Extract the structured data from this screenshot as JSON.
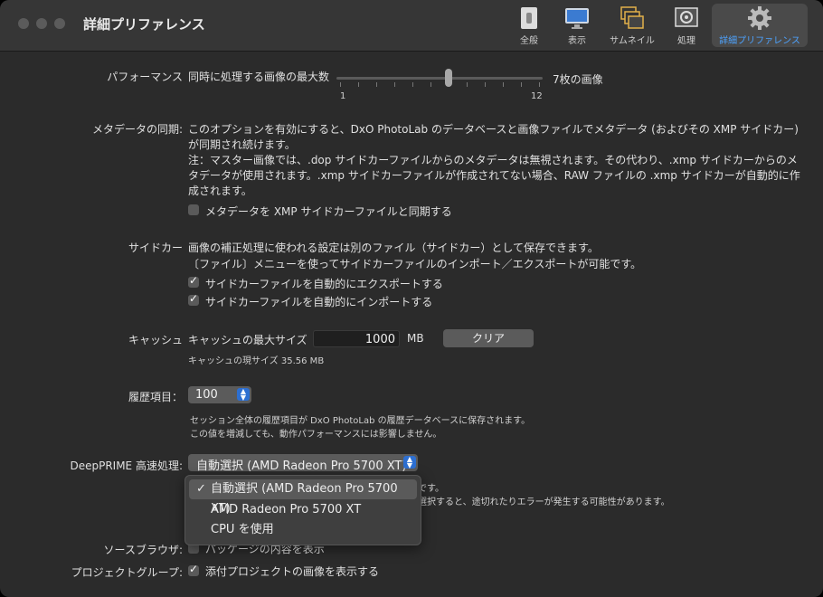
{
  "window": {
    "title": "詳細プリファレンス"
  },
  "toolbar": {
    "items": [
      {
        "label": "全般",
        "icon": "switch-icon"
      },
      {
        "label": "表示",
        "icon": "monitor-icon"
      },
      {
        "label": "サムネイル",
        "icon": "thumbnails-icon"
      },
      {
        "label": "処理",
        "icon": "processing-icon"
      },
      {
        "label": "詳細プリファレンス",
        "icon": "gear-icon"
      }
    ]
  },
  "performance": {
    "label": "パフォーマンス",
    "desc": "同時に処理する画像の最大数",
    "min": "1",
    "max": "12",
    "value_text": "7枚の画像",
    "value": 7
  },
  "metadata": {
    "label": "メタデータの同期:",
    "line1": "このオプションを有効にすると、DxO PhotoLab のデータベースと画像ファイルでメタデータ (およびその XMP サイドカー)",
    "line2": "が同期され続けます。",
    "line3": "注：マスター画像では、.dop サイドカーファイルからのメタデータは無視されます。その代わり、.xmp サイドカーからのメ",
    "line4": "タデータが使用されます。.xmp サイドカーファイルが作成されてない場合、RAW ファイルの .xmp サイドカーが自動的に作",
    "line5": "成されます。",
    "checkbox": "メタデータを XMP サイドカーファイルと同期する"
  },
  "sidecar": {
    "label": "サイドカー",
    "line1": "画像の補正処理に使われる設定は別のファイル（サイドカー）として保存できます。",
    "line2": "〔ファイル〕メニューを使ってサイドカーファイルのインポート／エクスポートが可能です。",
    "export": "サイドカーファイルを自動的にエクスポートする",
    "import": "サイドカーファイルを自動的にインポートする"
  },
  "cache": {
    "label": "キャッシュ",
    "max_label": "キャッシュの最大サイズ",
    "value": "1000",
    "unit": "MB",
    "clear": "クリア",
    "current": "キャッシュの現サイズ 35.56 MB"
  },
  "history": {
    "label": "履歴項目：",
    "value": "100",
    "note1": "セッション全体の履歴項目が DxO PhotoLab の履歴データベースに保存されます。",
    "note2": "この値を増減しても、動作パフォーマンスには影響しません。"
  },
  "deepprime": {
    "label": "DeepPRIME 高速処理:",
    "selected": "自動選択 (AMD Radeon Pro 5700 XT)",
    "options": [
      "自動選択 (AMD Radeon Pro 5700 XT)",
      "AMD Radeon Pro 5700 XT",
      "CPU を使用"
    ],
    "behind1": "です。",
    "behind2": "選択すると、途切れたりエラーが発生する可能性があります。"
  },
  "source_browser": {
    "label": "ソースブラウザ:",
    "checkbox": "パッケージの内容を表示"
  },
  "project_group": {
    "label": "プロジェクトグループ:",
    "checkbox": "添付プロジェクトの画像を表示する"
  }
}
